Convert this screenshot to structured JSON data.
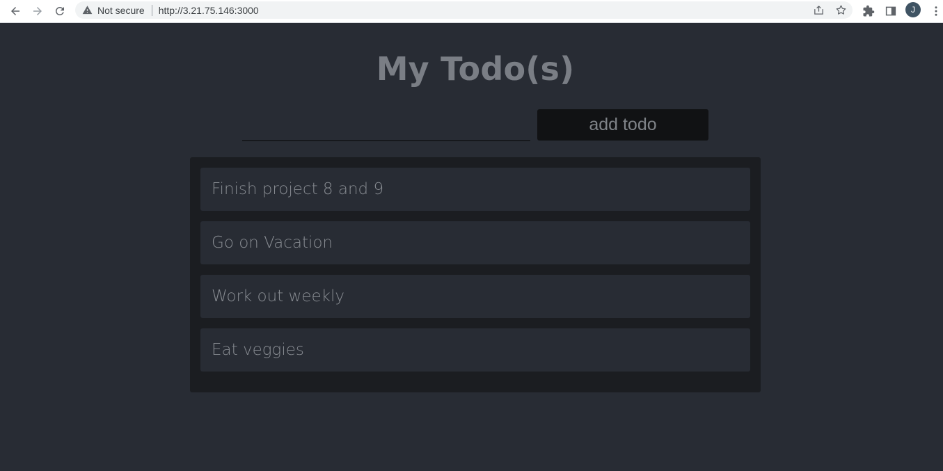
{
  "browser": {
    "security_label": "Not secure",
    "url": "http://3.21.75.146:3000",
    "profile_initial": "J"
  },
  "app": {
    "title": "My Todo(s)",
    "input": {
      "value": "",
      "placeholder": ""
    },
    "add_button_label": "add todo",
    "todos": [
      {
        "text": "Finish project 8 and 9"
      },
      {
        "text": "Go on Vacation"
      },
      {
        "text": "Work out weekly"
      },
      {
        "text": "Eat veggies"
      }
    ]
  },
  "colors": {
    "background": "#282c34",
    "panel": "#1b1d21",
    "button": "#111214",
    "text_muted": "#878b91"
  },
  "icons": [
    "back-arrow-icon",
    "forward-arrow-icon",
    "reload-icon",
    "warning-icon",
    "share-icon",
    "star-icon",
    "extensions-icon",
    "side-panel-icon",
    "more-vert-icon"
  ]
}
